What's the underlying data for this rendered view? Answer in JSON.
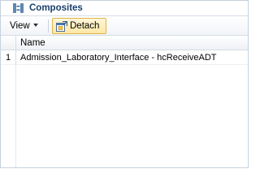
{
  "panel": {
    "title": "Composites",
    "title_icon": "composite-icon"
  },
  "toolbar": {
    "view_label": "View",
    "detach_label": "Detach",
    "detach_icon": "detach-window-icon"
  },
  "table": {
    "columns": [
      "Name"
    ],
    "rows": [
      {
        "num": "1",
        "name": "Admission_Laboratory_Interface - hcReceiveADT"
      }
    ]
  },
  "colors": {
    "title_text": "#1b3f6b",
    "detach_bg": "#fde7a6",
    "detach_border": "#e0b34a",
    "border": "#c6d1dd"
  }
}
